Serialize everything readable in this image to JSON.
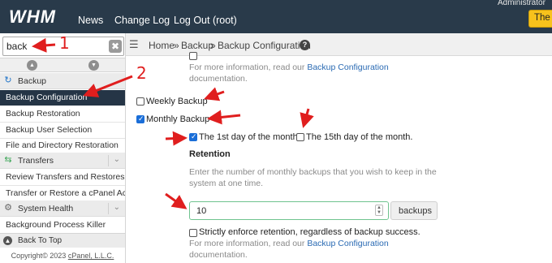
{
  "topbar": {
    "logo": "WHM",
    "nav": [
      "News",
      "Change Log",
      "Log Out (root)"
    ],
    "right_text": "Administrator",
    "right_button": "The la"
  },
  "sidebar": {
    "search_value": "back",
    "search_clear": "✖",
    "collapse_all": "▲",
    "expand_all": "▼",
    "categories": [
      {
        "label": "Backup",
        "icon": "backup-icon",
        "items": [
          "Backup Configuration",
          "Backup Restoration",
          "Backup User Selection",
          "File and Directory Restoration"
        ]
      },
      {
        "label": "Transfers",
        "icon": "transfers-icon",
        "items": [
          "Review Transfers and Restores",
          "Transfer or Restore a cPanel Account"
        ]
      },
      {
        "label": "System Health",
        "icon": "gear-icon",
        "items": [
          "Background Process Killer"
        ]
      }
    ],
    "back_to_top": "Back To Top",
    "copyright_prefix": "Copyright© 2023",
    "copyright_link": "cPanel, L.L.C."
  },
  "breadcrumb": {
    "home": "Home",
    "sep": "»",
    "section": "Backup",
    "page": "Backup Configuration",
    "help": "?"
  },
  "content": {
    "partial_retention_label": "Strictly enforce retention, regardless of backup success.",
    "info_prefix": "For more information, read our",
    "info_link": "Backup Configuration",
    "info_suffix": "documentation.",
    "weekly_label": "Weekly Backup",
    "weekly_checked": false,
    "monthly_label": "Monthly Backup",
    "monthly_checked": true,
    "first_day_label": "The 1st day of the month.",
    "first_day_checked": true,
    "fifteenth_day_label": "The 15th day of the month.",
    "fifteenth_day_checked": false,
    "retention_heading": "Retention",
    "retention_help_line1": "Enter the number of monthly backups that you wish to keep in the",
    "retention_help_line2": "system at one time.",
    "retention_value": "10",
    "retention_unit": "backups",
    "strict_label": "Strictly enforce retention, regardless of backup success.",
    "strict_checked": false
  },
  "annotations": {
    "number_1": "1",
    "number_2": "2",
    "color": "#e01e1e"
  }
}
